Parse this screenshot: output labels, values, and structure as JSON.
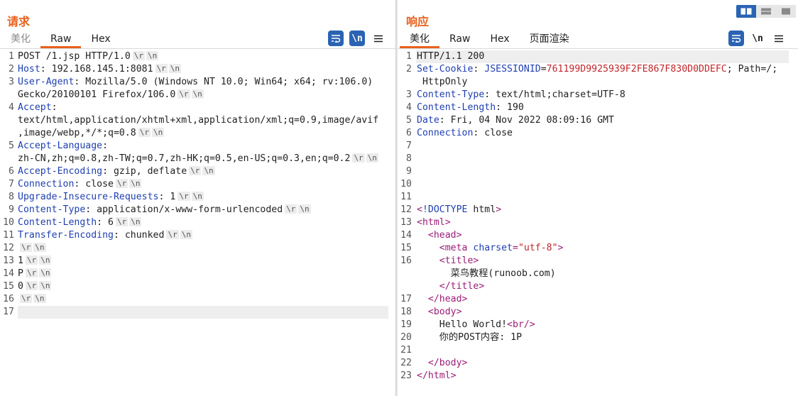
{
  "request": {
    "title": "请求",
    "tabs": [
      "美化",
      "Raw",
      "Hex"
    ],
    "active_tab": "Raw",
    "newline_toggle_label": "\\n",
    "lines": [
      {
        "n": "1",
        "segs": [
          {
            "t": "POST /1.jsp HTTP/1.0"
          }
        ],
        "crlf": true
      },
      {
        "n": "2",
        "segs": [
          {
            "t": "Host",
            "c": "k"
          },
          {
            "t": ": 192.168.145.1:8081"
          }
        ],
        "crlf": true
      },
      {
        "n": "3",
        "segs": [
          {
            "t": "User-Agent",
            "c": "k"
          },
          {
            "t": ": Mozilla/5.0 (Windows NT 10.0; Win64; x64; rv:106.0)"
          }
        ]
      },
      {
        "n": "",
        "segs": [
          {
            "t": "Gecko/20100101 Firefox/106.0"
          }
        ],
        "crlf": true
      },
      {
        "n": "4",
        "segs": [
          {
            "t": "Accept",
            "c": "k"
          },
          {
            "t": ":"
          }
        ]
      },
      {
        "n": "",
        "segs": [
          {
            "t": "text/html,application/xhtml+xml,application/xml;q=0.9,image/avif"
          }
        ]
      },
      {
        "n": "",
        "segs": [
          {
            "t": ",image/webp,*/*;q=0.8"
          }
        ],
        "crlf": true
      },
      {
        "n": "5",
        "segs": [
          {
            "t": "Accept-Language",
            "c": "k"
          },
          {
            "t": ":"
          }
        ]
      },
      {
        "n": "",
        "segs": [
          {
            "t": "zh-CN,zh;q=0.8,zh-TW;q=0.7,zh-HK;q=0.5,en-US;q=0.3,en;q=0.2"
          }
        ],
        "crlf": true
      },
      {
        "n": "6",
        "segs": [
          {
            "t": "Accept-Encoding",
            "c": "k"
          },
          {
            "t": ": gzip, deflate"
          }
        ],
        "crlf": true
      },
      {
        "n": "7",
        "segs": [
          {
            "t": "Connection",
            "c": "k"
          },
          {
            "t": ": close"
          }
        ],
        "crlf": true
      },
      {
        "n": "8",
        "segs": [
          {
            "t": "Upgrade-Insecure-Requests",
            "c": "k"
          },
          {
            "t": ": 1"
          }
        ],
        "crlf": true
      },
      {
        "n": "9",
        "segs": [
          {
            "t": "Content-Type",
            "c": "k"
          },
          {
            "t": ": application/x-www-form-urlencoded"
          }
        ],
        "crlf": true
      },
      {
        "n": "10",
        "segs": [
          {
            "t": "Content-Length",
            "c": "k"
          },
          {
            "t": ": 6"
          }
        ],
        "crlf": true
      },
      {
        "n": "11",
        "segs": [
          {
            "t": "Transfer-Encoding",
            "c": "k"
          },
          {
            "t": ": chunked"
          }
        ],
        "crlf": true
      },
      {
        "n": "12",
        "segs": [],
        "crlf": true
      },
      {
        "n": "13",
        "segs": [
          {
            "t": "1"
          }
        ],
        "crlf": true
      },
      {
        "n": "14",
        "segs": [
          {
            "t": "P"
          }
        ],
        "crlf": true
      },
      {
        "n": "15",
        "segs": [
          {
            "t": "0"
          }
        ],
        "crlf": true
      },
      {
        "n": "16",
        "segs": [],
        "crlf": true
      },
      {
        "n": "17",
        "segs": [],
        "current": true
      }
    ]
  },
  "response": {
    "title": "响应",
    "tabs": [
      "美化",
      "Raw",
      "Hex",
      "页面渲染"
    ],
    "active_tab": "美化",
    "newline_toggle_label": "\\n",
    "lines": [
      {
        "n": "1",
        "segs": [
          {
            "t": "HTTP/1.1 200"
          }
        ],
        "current": true
      },
      {
        "n": "2",
        "segs": [
          {
            "t": "Set-Cookie",
            "c": "k"
          },
          {
            "t": ": "
          },
          {
            "t": "JSESSIONID",
            "c": "k"
          },
          {
            "t": "="
          },
          {
            "t": "761199D9925939F2FE867F830D0DDEFC",
            "c": "s"
          },
          {
            "t": "; Path=/;"
          }
        ]
      },
      {
        "n": "",
        "segs": [
          {
            "t": " HttpOnly"
          }
        ]
      },
      {
        "n": "3",
        "segs": [
          {
            "t": "Content-Type",
            "c": "k"
          },
          {
            "t": ": text/html;charset=UTF-8"
          }
        ]
      },
      {
        "n": "4",
        "segs": [
          {
            "t": "Content-Length",
            "c": "k"
          },
          {
            "t": ": 190"
          }
        ]
      },
      {
        "n": "5",
        "segs": [
          {
            "t": "Date",
            "c": "k"
          },
          {
            "t": ": Fri, 04 Nov 2022 08:09:16 GMT"
          }
        ]
      },
      {
        "n": "6",
        "segs": [
          {
            "t": "Connection",
            "c": "k"
          },
          {
            "t": ": close"
          }
        ]
      },
      {
        "n": "7",
        "segs": []
      },
      {
        "n": "8",
        "segs": []
      },
      {
        "n": "9",
        "segs": []
      },
      {
        "n": "10",
        "segs": []
      },
      {
        "n": "11",
        "segs": []
      },
      {
        "n": "12",
        "segs": [
          {
            "t": "<",
            "c": "t"
          },
          {
            "t": "!DOCTYPE ",
            "c": "k"
          },
          {
            "t": "html"
          },
          {
            "t": ">",
            "c": "t"
          }
        ]
      },
      {
        "n": "13",
        "segs": [
          {
            "t": "<html>",
            "c": "t"
          }
        ]
      },
      {
        "n": "14",
        "segs": [
          {
            "t": "  "
          },
          {
            "t": "<head>",
            "c": "t"
          }
        ]
      },
      {
        "n": "15",
        "segs": [
          {
            "t": "    "
          },
          {
            "t": "<meta ",
            "c": "t"
          },
          {
            "t": "charset",
            "c": "k"
          },
          {
            "t": "=",
            "c": "t"
          },
          {
            "t": "\"utf-8\"",
            "c": "s"
          },
          {
            "t": ">",
            "c": "t"
          }
        ]
      },
      {
        "n": "16",
        "segs": [
          {
            "t": "    "
          },
          {
            "t": "<title>",
            "c": "t"
          }
        ]
      },
      {
        "n": "",
        "segs": [
          {
            "t": "      菜鸟教程(runoob.com)"
          }
        ]
      },
      {
        "n": "",
        "segs": [
          {
            "t": "    "
          },
          {
            "t": "</title>",
            "c": "t"
          }
        ]
      },
      {
        "n": "17",
        "segs": [
          {
            "t": "  "
          },
          {
            "t": "</head>",
            "c": "t"
          }
        ]
      },
      {
        "n": "18",
        "segs": [
          {
            "t": "  "
          },
          {
            "t": "<body>",
            "c": "t"
          }
        ]
      },
      {
        "n": "19",
        "segs": [
          {
            "t": "    Hello World!"
          },
          {
            "t": "<br/>",
            "c": "t"
          }
        ]
      },
      {
        "n": "20",
        "segs": [
          {
            "t": "    你的POST内容: 1P"
          }
        ]
      },
      {
        "n": "21",
        "segs": []
      },
      {
        "n": "22",
        "segs": [
          {
            "t": "  "
          },
          {
            "t": "</body>",
            "c": "t"
          }
        ]
      },
      {
        "n": "23",
        "segs": [
          {
            "t": "</html>",
            "c": "t"
          }
        ]
      }
    ]
  },
  "crlf_tokens": [
    "\\r",
    "\\n"
  ],
  "icons": {
    "wrap": "word-wrap-icon",
    "newline": "show-newlines-icon",
    "menu": "hamburger-menu-icon",
    "layout": [
      "split-horizontal-icon",
      "split-vertical-icon",
      "single-pane-icon"
    ]
  },
  "colors": {
    "accent": "#e8601c",
    "header_key": "#1f3fb0",
    "string_value": "#c0262b",
    "tag": "#9b1d76",
    "button_blue": "#2b63b3"
  }
}
